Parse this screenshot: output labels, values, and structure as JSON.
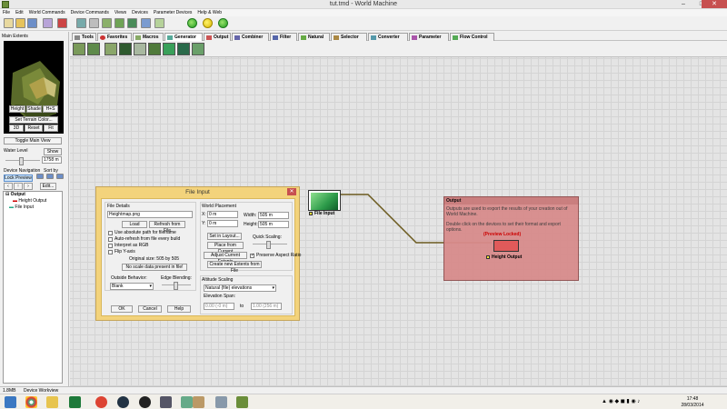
{
  "window": {
    "title": "tut.tmd - World Machine",
    "min": "–",
    "max": "□",
    "close": "✕"
  },
  "menu": [
    "File",
    "Edit",
    "World Commands",
    "Device Commands",
    "Views",
    "Devices",
    "Parameter Devices",
    "Help & Web"
  ],
  "left_panel": {
    "header": "Main Extents",
    "view_buttons": [
      "Height",
      "Shade",
      "H+S"
    ],
    "set_terrain_colors": "Set Terrain Color...",
    "mode_buttons": [
      "3D",
      "Reset",
      "Fit"
    ],
    "toggle_main_view": "Toggle Main View",
    "water_level_label": "Water Level",
    "show_button": "Show",
    "water_value": "1758 m",
    "device_navigation": "Device Navigation",
    "sort_by": "Sort by",
    "lock_preview": "Lock Preview",
    "edit_button": "Edit...",
    "tree": [
      "Output",
      "Height Output",
      "File Input"
    ]
  },
  "tabs": [
    "Tools",
    "Favorites",
    "Macros",
    "Generator",
    "Output",
    "Combiner",
    "Filter",
    "Natural",
    "Selector",
    "Converter",
    "Parameter",
    "Flow Control"
  ],
  "active_tab": "Generator",
  "dialog": {
    "title": "File Input",
    "close": "✕",
    "file_details": "File Details",
    "filename": "Heightmap.png",
    "load": "Load",
    "refresh": "Refresh from File",
    "checks": [
      "Use absolute path for filename",
      "Auto-refresh from file every build",
      "Interpret as RGB",
      "Flip Y-axis"
    ],
    "original_size": "Original size: 505 by 505",
    "no_scale": "No scale data present in file!",
    "outside_behavior": "Outside Behavior:",
    "outside_value": "Blank",
    "edge_blending": "Edge Blending:",
    "world_placement": "World Placement",
    "x_label": "X:",
    "x_value": "0 m",
    "y_label": "Y:",
    "y_value": "0 m",
    "width_label": "Width:",
    "width_value": "505 m",
    "height_label": "Height:",
    "height_value": "505 m",
    "set_in_layout": "Set in Layout...",
    "place_current": "Place from Current",
    "quick_scaling": "Quick Scaling:",
    "adjust_extents": "Adjust Current Extents",
    "preserve_aspect": "Preserve Aspect Ratio",
    "create_extents": "Create new Extents from File",
    "altitude_scaling": "Altitude Scaling",
    "altitude_value": "Natural (file) elevations",
    "elevation_span": "Elevation Span:",
    "span_from": "0.00 (-0 m)",
    "span_to_label": "to",
    "span_to": "1.00 (256 m)",
    "ok": "OK",
    "cancel": "Cancel",
    "help": "Help"
  },
  "nodes": {
    "file_input": "File Input",
    "output_group_title": "Output",
    "output_group_text1": "Outputs are used to export the results of your creation out of World Machine.",
    "output_group_text2": "Double click on the devices to set their format and export options.",
    "preview_locked": "(Preview Locked)",
    "height_output": "Height Output"
  },
  "status": {
    "memory": "1.8MB",
    "mode": "Device Workview"
  },
  "clock": {
    "time": "17:48",
    "date": "28/03/2014"
  },
  "colors": {
    "dialog_frame": "#f3d37c",
    "output_group": "#d88c8c",
    "connection": "#6b5a1e"
  }
}
